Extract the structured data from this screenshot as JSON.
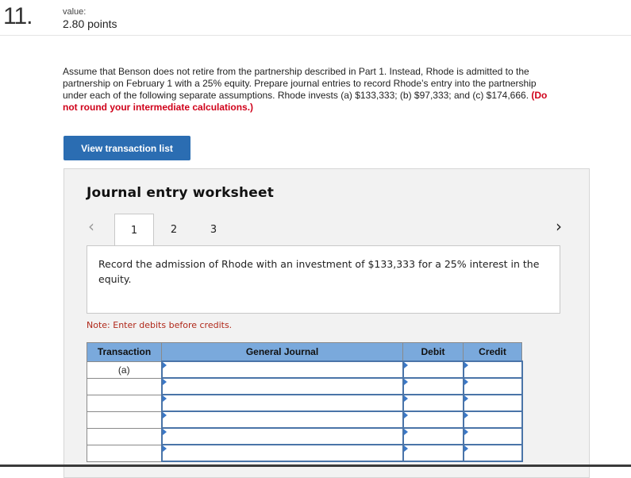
{
  "question": {
    "number": "11.",
    "value_label": "value:",
    "value_points": "2.80 points",
    "text": "Assume that Benson does not retire from the partnership described in Part 1. Instead, Rhode is admitted to the partnership on February 1 with a 25% equity. Prepare journal entries to record Rhode’s entry into the partnership under each of the following separate assumptions. Rhode invests (a) $133,333; (b) $97,333; and (c) $174,666.",
    "emphasis": "(Do not round your intermediate calculations.)"
  },
  "buttons": {
    "view_transactions": "View transaction list"
  },
  "worksheet": {
    "title": "Journal entry worksheet",
    "prev_glyph": "‹",
    "next_glyph": "›",
    "tabs": [
      {
        "label": "1",
        "active": true
      },
      {
        "label": "2",
        "active": false
      },
      {
        "label": "3",
        "active": false
      }
    ],
    "instruction": "Record the admission of Rhode with an investment of $133,333 for a 25% interest in the equity.",
    "note": "Note: Enter debits before credits.",
    "table": {
      "headers": [
        "Transaction",
        "General Journal",
        "Debit",
        "Credit"
      ],
      "rows": [
        {
          "transaction": "(a)"
        },
        {
          "transaction": ""
        },
        {
          "transaction": ""
        },
        {
          "transaction": ""
        },
        {
          "transaction": ""
        },
        {
          "transaction": ""
        }
      ]
    }
  }
}
